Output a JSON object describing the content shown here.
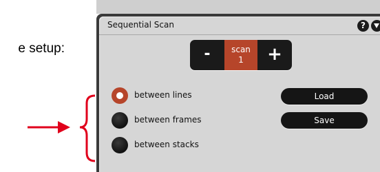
{
  "annotation": {
    "text": "e setup:",
    "arrow_color": "#e0001b"
  },
  "panel": {
    "title": "Sequential Scan",
    "help_icon": "question-icon",
    "menu_icon": "chevron-down-icon"
  },
  "scan_stepper": {
    "minus_label": "-",
    "plus_label": "+",
    "value_label": "scan",
    "value": "1"
  },
  "scan_modes": [
    {
      "label": "between lines",
      "selected": true
    },
    {
      "label": "between frames",
      "selected": false
    },
    {
      "label": "between stacks",
      "selected": false
    }
  ],
  "buttons": {
    "load_label": "Load",
    "save_label": "Save"
  },
  "colors": {
    "accent": "#b6452a",
    "panel_bg": "#d6d6d6",
    "control_dark": "#151515"
  }
}
